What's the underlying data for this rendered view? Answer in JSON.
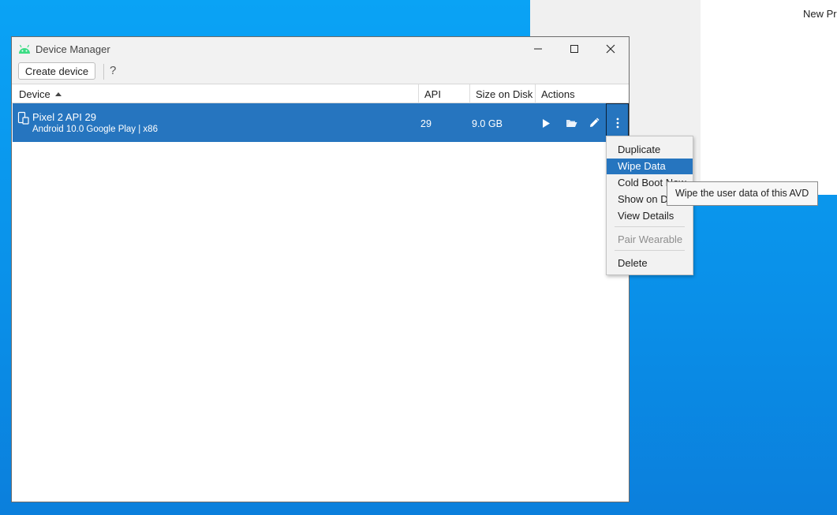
{
  "background": {
    "window_text": "New Pro"
  },
  "window": {
    "title": "Device Manager",
    "controls": {
      "minimize": "minimize-icon",
      "maximize": "maximize-icon",
      "close": "close-icon"
    }
  },
  "toolbar": {
    "create_label": "Create device",
    "help_label": "?"
  },
  "table": {
    "columns": [
      "Device",
      "API",
      "Size on Disk",
      "Actions"
    ],
    "sort": "ascending",
    "rows": [
      {
        "name": "Pixel 2 API 29",
        "subtitle": "Android 10.0 Google Play | x86",
        "api": "29",
        "size": "9.0 GB",
        "selected": true
      }
    ]
  },
  "menu": {
    "items": [
      {
        "label": "Duplicate",
        "state": "normal"
      },
      {
        "label": "Wipe Data",
        "state": "highlighted"
      },
      {
        "label": "Cold Boot Now",
        "state": "normal"
      },
      {
        "label": "Show on Disk",
        "state": "normal"
      },
      {
        "label": "View Details",
        "state": "normal"
      },
      {
        "label": "Pair Wearable",
        "state": "disabled"
      },
      {
        "label": "Delete",
        "state": "normal"
      }
    ]
  },
  "tooltip": {
    "text": "Wipe the user data of this AVD"
  },
  "colors": {
    "selection": "#2675bf",
    "desktop": "#0a8fe8",
    "android_green": "#3ddc84"
  }
}
